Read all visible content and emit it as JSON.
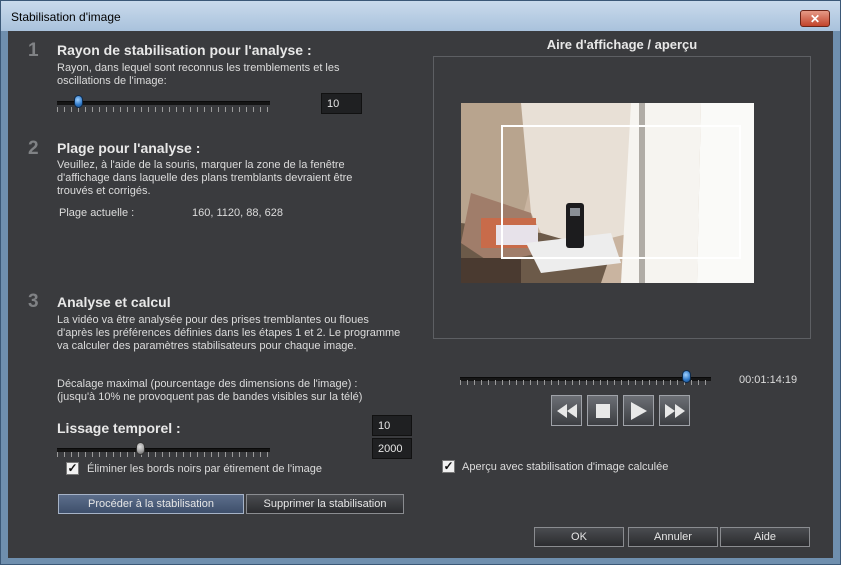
{
  "window": {
    "title": "Stabilisation d'image",
    "close_label": "✕"
  },
  "step1": {
    "number": "1",
    "heading": "Rayon de stabilisation pour l'analyse :",
    "description": "Rayon, dans lequel sont reconnus les tremblements et les oscillations de l'image:",
    "slider_value": 0.1,
    "value": "10"
  },
  "step2": {
    "number": "2",
    "heading": "Plage pour l'analyse :",
    "description": "Veuillez, à l'aide de la souris, marquer la zone de la fenêtre d'affichage dans laquelle des plans tremblants devraient être trouvés et corrigés.",
    "current_range_label": "Plage actuelle :",
    "current_range_value": "160, 1120, 88, 628"
  },
  "step3": {
    "number": "3",
    "heading": "Analyse et calcul",
    "description": "La vidéo va être analysée pour des prises tremblantes ou floues d'après les préférences définies dans les étapes 1 et 2. Le programme va calculer des paramètres stabilisateurs pour chaque image.",
    "offset_note": "Décalage maximal (pourcentage des dimensions de l'image) : (jusqu'à 10% ne provoquent pas de bandes visibles sur la télé)",
    "offset_value": "10",
    "smoothing_label": "Lissage temporel :",
    "smoothing_slider_value": 0.39,
    "smoothing_value": "2000",
    "black_borders_label": "Éliminer les bords noirs par étirement de l'image",
    "black_borders_checked": true,
    "stabilize_button": "Procéder à la stabilisation",
    "remove_button": "Supprimer la stabilisation"
  },
  "preview": {
    "title": "Aire d'affichage / aperçu",
    "timecode": "00:01:14:19",
    "position": 0.9,
    "transport": [
      "rewind-icon",
      "stop-icon",
      "play-icon",
      "fast-forward-icon"
    ],
    "stabilized_preview_label": "Aperçu avec stabilisation d'image calculée",
    "stabilized_preview_checked": true
  },
  "footer": {
    "ok": "OK",
    "cancel": "Annuler",
    "help": "Aide"
  }
}
